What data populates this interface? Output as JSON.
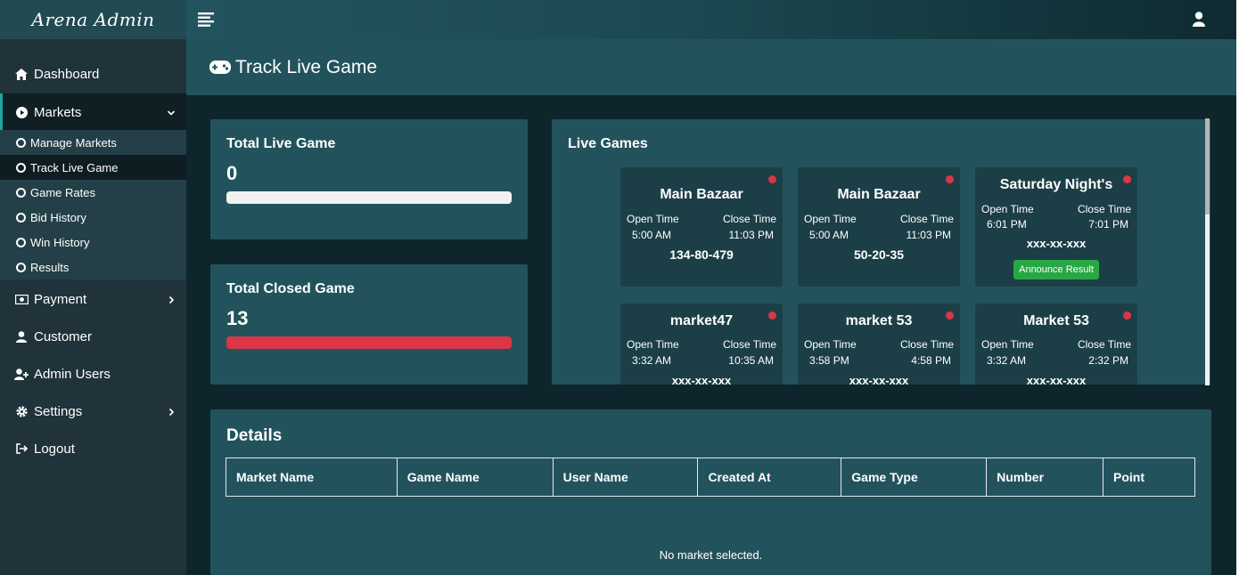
{
  "sidebar": {
    "brand": "Arena Admin",
    "items": [
      {
        "label": "Dashboard"
      },
      {
        "label": "Markets"
      },
      {
        "label": "Payment"
      },
      {
        "label": "Customer"
      },
      {
        "label": "Admin Users"
      },
      {
        "label": "Settings"
      },
      {
        "label": "Logout"
      }
    ],
    "markets_sub": [
      {
        "label": "Manage Markets"
      },
      {
        "label": "Track Live Game"
      },
      {
        "label": "Game Rates"
      },
      {
        "label": "Bid History"
      },
      {
        "label": "Win History"
      },
      {
        "label": "Results"
      }
    ]
  },
  "page": {
    "title": "Track Live Game"
  },
  "stats": {
    "live_title": "Total Live Game",
    "live_value": "0",
    "closed_title": "Total Closed Game",
    "closed_value": "13"
  },
  "live_games": {
    "title": "Live Games",
    "open_label": "Open Time",
    "close_label": "Close Time",
    "games": [
      {
        "name": "Main Bazaar",
        "open": "5:00 AM",
        "close": "11:03 PM",
        "number": "134-80-479"
      },
      {
        "name": "Main Bazaar",
        "open": "5:00 AM",
        "close": "11:03 PM",
        "number": "50-20-35"
      },
      {
        "name": "Saturday Night's",
        "open": "6:01 PM",
        "close": "7:01 PM",
        "number": "xxx-xx-xxx",
        "button": "Announce Result"
      },
      {
        "name": "market47",
        "open": "3:32 AM",
        "close": "10:35 AM",
        "number": "xxx-xx-xxx"
      },
      {
        "name": "market 53",
        "open": "3:58 PM",
        "close": "4:58 PM",
        "number": "xxx-xx-xxx"
      },
      {
        "name": "Market 53",
        "open": "3:32 AM",
        "close": "2:32 PM",
        "number": "xxx-xx-xxx"
      }
    ]
  },
  "details": {
    "title": "Details",
    "columns": [
      "Market Name",
      "Game Name",
      "User Name",
      "Created At",
      "Game Type",
      "Number",
      "Point"
    ],
    "empty": "No market selected."
  },
  "colors": {
    "accent_red": "#dc3545",
    "accent_green": "#28a745",
    "panel": "#22535d",
    "background": "#0e252c"
  }
}
